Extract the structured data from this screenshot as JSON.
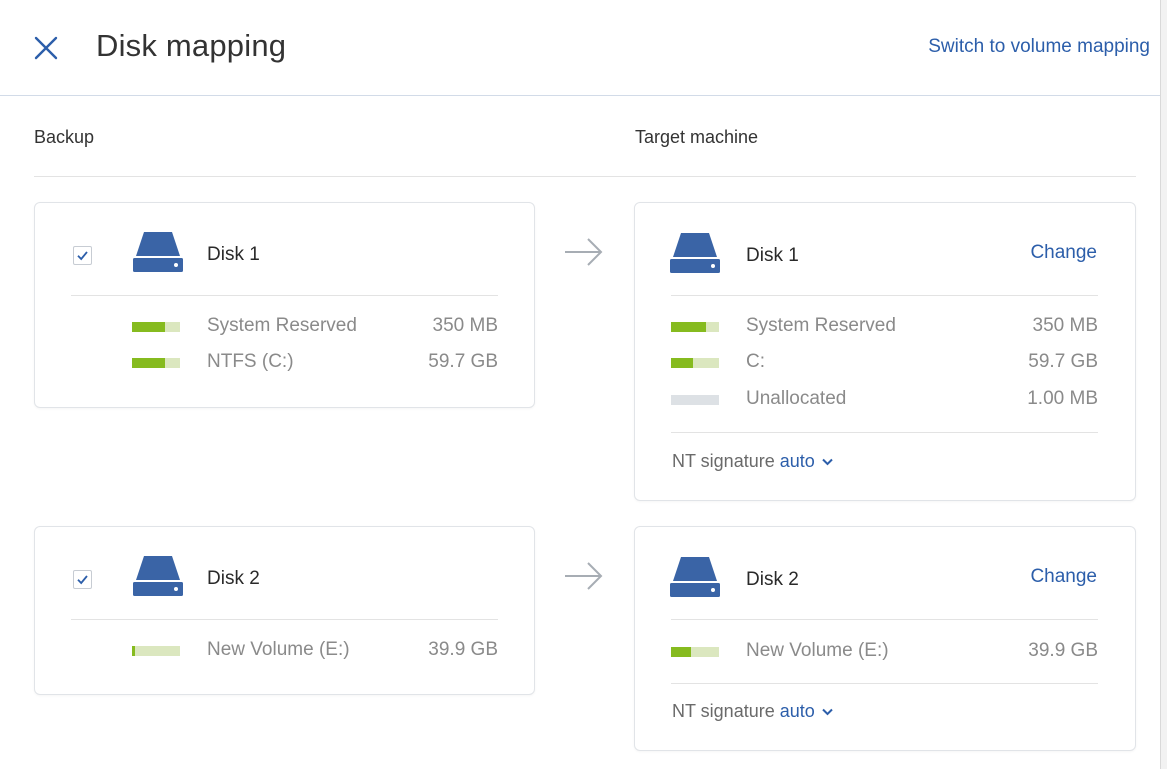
{
  "header": {
    "title": "Disk mapping",
    "switch_link": "Switch to volume mapping"
  },
  "columns": {
    "backup": "Backup",
    "target": "Target machine"
  },
  "colors": {
    "accent": "#2c5eaa",
    "partition_fill": "#86bb1f",
    "partition_track": "#dbe7bf",
    "unallocated": "#dde1e5",
    "disk_icon": "#3a64a6"
  },
  "mappings": [
    {
      "backup": {
        "name": "Disk 1",
        "checked": true,
        "partitions": [
          {
            "label": "System Reserved",
            "size": "350 MB",
            "fill": 0.68
          },
          {
            "label": "NTFS (C:)",
            "size": "59.7 GB",
            "fill": 0.68
          }
        ]
      },
      "target": {
        "name": "Disk 1",
        "change_label": "Change",
        "partitions": [
          {
            "label": "System Reserved",
            "size": "350 MB",
            "fill": 0.72
          },
          {
            "label": "C:",
            "size": "59.7 GB",
            "fill": 0.45
          },
          {
            "label": "Unallocated",
            "size": "1.00 MB",
            "fill": 0
          }
        ],
        "nt_signature_label": "NT signature",
        "nt_signature_value": "auto"
      }
    },
    {
      "backup": {
        "name": "Disk 2",
        "checked": true,
        "partitions": [
          {
            "label": "New Volume (E:)",
            "size": "39.9 GB",
            "fill": 0.06
          }
        ]
      },
      "target": {
        "name": "Disk 2",
        "change_label": "Change",
        "partitions": [
          {
            "label": "New Volume (E:)",
            "size": "39.9 GB",
            "fill": 0.42
          }
        ],
        "nt_signature_label": "NT signature",
        "nt_signature_value": "auto"
      }
    }
  ]
}
